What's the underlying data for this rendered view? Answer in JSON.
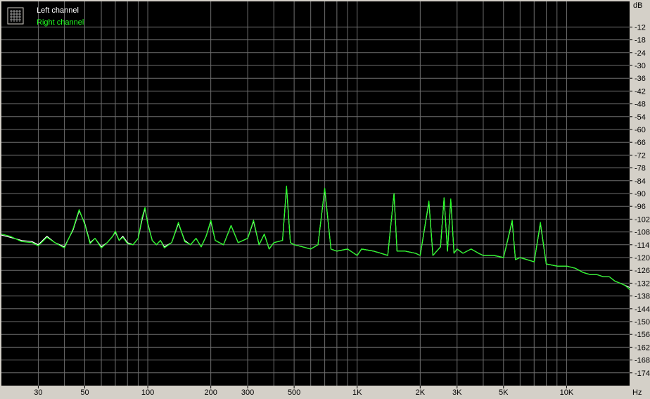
{
  "chart_data": {
    "type": "line",
    "title": "",
    "ylabel": "dB",
    "xlabel": "Hz",
    "x_scale": "log",
    "xlim": [
      20,
      20000
    ],
    "ylim": [
      -180,
      0
    ],
    "grid": true,
    "legend_position": "top-left",
    "y_ticks": [
      "-12",
      "-18",
      "-24",
      "-30",
      "-36",
      "-42",
      "-48",
      "-54",
      "-60",
      "-66",
      "-72",
      "-78",
      "-84",
      "-90",
      "-96",
      "-102",
      "-108",
      "-114",
      "-120",
      "-126",
      "-132",
      "-138",
      "-144",
      "-150",
      "-156",
      "-162",
      "-168",
      "-174"
    ],
    "x_tick_labels": [
      {
        "value": 30,
        "label": "30"
      },
      {
        "value": 50,
        "label": "50"
      },
      {
        "value": 100,
        "label": "100"
      },
      {
        "value": 200,
        "label": "200"
      },
      {
        "value": 300,
        "label": "300"
      },
      {
        "value": 500,
        "label": "500"
      },
      {
        "value": 1000,
        "label": "1K"
      },
      {
        "value": 2000,
        "label": "2K"
      },
      {
        "value": 3000,
        "label": "3K"
      },
      {
        "value": 5000,
        "label": "5K"
      },
      {
        "value": 10000,
        "label": "10K"
      }
    ],
    "series": [
      {
        "name": "Left channel",
        "color": "#ffffff",
        "points": [
          [
            20,
            -109.5
          ],
          [
            22,
            -110.5
          ],
          [
            25,
            -112
          ],
          [
            28,
            -112.5
          ],
          [
            30,
            -114
          ],
          [
            33,
            -110
          ],
          [
            36,
            -113
          ],
          [
            40,
            -115
          ],
          [
            44,
            -107
          ],
          [
            47,
            -98
          ],
          [
            50,
            -104
          ],
          [
            53,
            -113
          ],
          [
            56,
            -111
          ],
          [
            60,
            -115
          ],
          [
            64,
            -113
          ],
          [
            68,
            -110
          ],
          [
            70,
            -108
          ],
          [
            73,
            -112
          ],
          [
            76,
            -110
          ],
          [
            80,
            -113
          ],
          [
            85,
            -114
          ],
          [
            90,
            -111
          ],
          [
            94,
            -102
          ],
          [
            97,
            -97
          ],
          [
            100,
            -104
          ],
          [
            105,
            -112
          ],
          [
            110,
            -114
          ],
          [
            115,
            -112
          ],
          [
            120,
            -115
          ],
          [
            130,
            -113
          ],
          [
            140,
            -104
          ],
          [
            150,
            -112
          ],
          [
            160,
            -114
          ],
          [
            170,
            -111
          ],
          [
            180,
            -115
          ],
          [
            190,
            -110
          ],
          [
            200,
            -103
          ],
          [
            210,
            -112
          ],
          [
            230,
            -114
          ],
          [
            250,
            -105
          ],
          [
            270,
            -113
          ],
          [
            300,
            -111
          ],
          [
            320,
            -103
          ],
          [
            340,
            -114
          ],
          [
            360,
            -109
          ],
          [
            380,
            -116
          ],
          [
            400,
            -113
          ],
          [
            440,
            -112
          ],
          [
            460,
            -87
          ],
          [
            480,
            -113
          ],
          [
            500,
            -114
          ],
          [
            550,
            -115
          ],
          [
            600,
            -116
          ],
          [
            650,
            -114
          ],
          [
            700,
            -88
          ],
          [
            750,
            -116
          ],
          [
            800,
            -117
          ],
          [
            900,
            -116
          ],
          [
            1000,
            -119
          ],
          [
            1050,
            -116
          ],
          [
            1200,
            -117
          ],
          [
            1300,
            -118
          ],
          [
            1400,
            -119
          ],
          [
            1500,
            -90
          ],
          [
            1550,
            -117
          ],
          [
            1700,
            -117
          ],
          [
            1900,
            -118
          ],
          [
            2000,
            -119
          ],
          [
            2200,
            -94
          ],
          [
            2300,
            -119
          ],
          [
            2500,
            -115
          ],
          [
            2600,
            -92
          ],
          [
            2700,
            -117
          ],
          [
            2800,
            -93
          ],
          [
            2900,
            -118
          ],
          [
            3000,
            -116
          ],
          [
            3200,
            -118
          ],
          [
            3500,
            -116
          ],
          [
            3800,
            -118
          ],
          [
            4000,
            -119
          ],
          [
            4500,
            -119
          ],
          [
            5000,
            -120
          ],
          [
            5500,
            -103
          ],
          [
            5700,
            -121
          ],
          [
            6000,
            -120
          ],
          [
            7000,
            -122
          ],
          [
            7500,
            -104
          ],
          [
            8000,
            -123
          ],
          [
            9000,
            -124
          ],
          [
            10000,
            -124
          ],
          [
            11000,
            -125
          ],
          [
            12000,
            -127
          ],
          [
            13000,
            -128
          ],
          [
            14000,
            -128
          ],
          [
            15000,
            -129
          ],
          [
            16000,
            -129
          ],
          [
            17000,
            -131
          ],
          [
            18000,
            -132
          ],
          [
            19000,
            -133
          ],
          [
            20000,
            -134
          ]
        ]
      },
      {
        "name": "Right channel",
        "color": "#22ff22",
        "points": [
          [
            20,
            -109
          ],
          [
            22,
            -110
          ],
          [
            25,
            -112.5
          ],
          [
            28,
            -113
          ],
          [
            30,
            -114.5
          ],
          [
            33,
            -110.5
          ],
          [
            36,
            -113
          ],
          [
            40,
            -115.5
          ],
          [
            44,
            -106.5
          ],
          [
            47,
            -97.5
          ],
          [
            50,
            -104.5
          ],
          [
            53,
            -113.5
          ],
          [
            56,
            -111
          ],
          [
            60,
            -115.5
          ],
          [
            64,
            -113
          ],
          [
            68,
            -110
          ],
          [
            70,
            -107.5
          ],
          [
            73,
            -112
          ],
          [
            76,
            -110.5
          ],
          [
            80,
            -113.5
          ],
          [
            85,
            -114
          ],
          [
            90,
            -111
          ],
          [
            94,
            -101
          ],
          [
            97,
            -96.5
          ],
          [
            100,
            -104.5
          ],
          [
            105,
            -112
          ],
          [
            110,
            -114
          ],
          [
            115,
            -112
          ],
          [
            120,
            -115.5
          ],
          [
            130,
            -113
          ],
          [
            140,
            -103.5
          ],
          [
            150,
            -112.5
          ],
          [
            160,
            -114
          ],
          [
            170,
            -111
          ],
          [
            180,
            -115
          ],
          [
            190,
            -110
          ],
          [
            200,
            -102.5
          ],
          [
            210,
            -112
          ],
          [
            230,
            -114
          ],
          [
            250,
            -105
          ],
          [
            270,
            -113
          ],
          [
            300,
            -111
          ],
          [
            320,
            -102.5
          ],
          [
            340,
            -114
          ],
          [
            360,
            -109
          ],
          [
            380,
            -116
          ],
          [
            400,
            -113
          ],
          [
            440,
            -112
          ],
          [
            460,
            -86.5
          ],
          [
            480,
            -113
          ],
          [
            500,
            -114
          ],
          [
            550,
            -115
          ],
          [
            600,
            -116
          ],
          [
            650,
            -114
          ],
          [
            700,
            -87.5
          ],
          [
            750,
            -116
          ],
          [
            800,
            -117
          ],
          [
            900,
            -116
          ],
          [
            1000,
            -119
          ],
          [
            1050,
            -116
          ],
          [
            1200,
            -117
          ],
          [
            1300,
            -118
          ],
          [
            1400,
            -119
          ],
          [
            1500,
            -90
          ],
          [
            1550,
            -117
          ],
          [
            1700,
            -117
          ],
          [
            1900,
            -118
          ],
          [
            2000,
            -119
          ],
          [
            2200,
            -93.5
          ],
          [
            2300,
            -119
          ],
          [
            2500,
            -115
          ],
          [
            2600,
            -92
          ],
          [
            2700,
            -117
          ],
          [
            2800,
            -92.5
          ],
          [
            2900,
            -118
          ],
          [
            3000,
            -116
          ],
          [
            3200,
            -118
          ],
          [
            3500,
            -116
          ],
          [
            3800,
            -118
          ],
          [
            4000,
            -119
          ],
          [
            4500,
            -119
          ],
          [
            5000,
            -120
          ],
          [
            5500,
            -102.5
          ],
          [
            5700,
            -121
          ],
          [
            6000,
            -120
          ],
          [
            7000,
            -122
          ],
          [
            7500,
            -103.5
          ],
          [
            8000,
            -123
          ],
          [
            9000,
            -124
          ],
          [
            10000,
            -124
          ],
          [
            11000,
            -125
          ],
          [
            12000,
            -127
          ],
          [
            13000,
            -128
          ],
          [
            14000,
            -128
          ],
          [
            15000,
            -129
          ],
          [
            16000,
            -129
          ],
          [
            17000,
            -131
          ],
          [
            18000,
            -132
          ],
          [
            19000,
            -133
          ],
          [
            20000,
            -135
          ]
        ]
      }
    ],
    "colors": {
      "background": "#000000",
      "grid": "#6e6e6e",
      "frame": "#d4d0c8"
    }
  }
}
